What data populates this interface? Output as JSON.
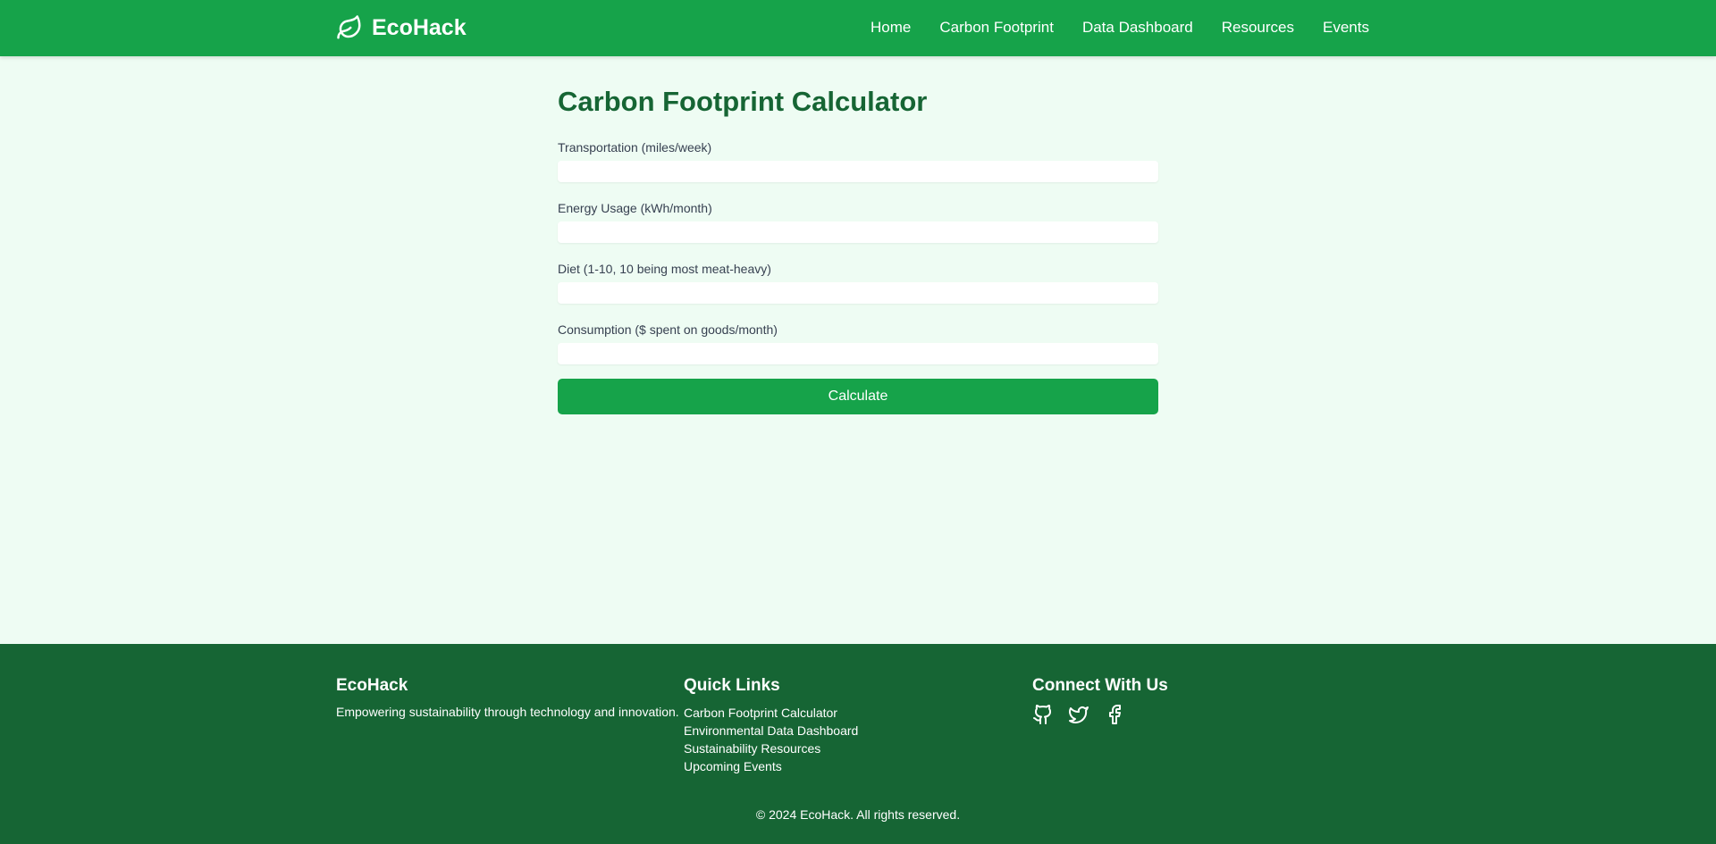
{
  "header": {
    "brand": "EcoHack",
    "brand_icon": "leaf-icon",
    "nav": [
      "Home",
      "Carbon Footprint",
      "Data Dashboard",
      "Resources",
      "Events"
    ]
  },
  "main": {
    "title": "Carbon Footprint Calculator",
    "fields": [
      {
        "label": "Transportation (miles/week)",
        "value": ""
      },
      {
        "label": "Energy Usage (kWh/month)",
        "value": ""
      },
      {
        "label": "Diet (1-10, 10 being most meat-heavy)",
        "value": ""
      },
      {
        "label": "Consumption ($ spent on goods/month)",
        "value": ""
      }
    ],
    "button": "Calculate"
  },
  "footer": {
    "brand_heading": "EcoHack",
    "tagline": "Empowering sustainability through technology and innovation.",
    "links_heading": "Quick Links",
    "links": [
      "Carbon Footprint Calculator",
      "Environmental Data Dashboard",
      "Sustainability Resources",
      "Upcoming Events"
    ],
    "connect_heading": "Connect With Us",
    "social_icons": [
      "github-icon",
      "twitter-icon",
      "facebook-icon"
    ],
    "copyright": "© 2024 EcoHack. All rights reserved."
  },
  "colors": {
    "primary": "#16a34a",
    "dark": "#166534",
    "background": "#eefcf3"
  }
}
